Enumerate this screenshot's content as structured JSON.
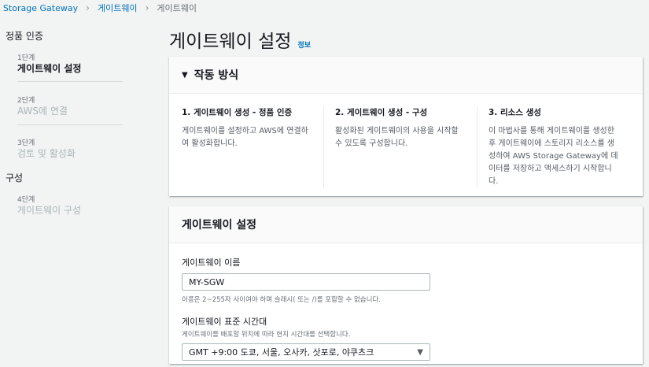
{
  "breadcrumb": {
    "items": [
      "Storage Gateway",
      "게이트웨이",
      "게이트웨이"
    ]
  },
  "sidebar": {
    "sections": [
      {
        "title": "정품 인증",
        "steps": [
          {
            "step": "1단계",
            "name": "게이트웨이 설정"
          },
          {
            "step": "2단계",
            "name": "AWS에 연결"
          },
          {
            "step": "3단계",
            "name": "검토 및 활성화"
          }
        ]
      },
      {
        "title": "구성",
        "steps": [
          {
            "step": "4단계",
            "name": "게이트웨이 구성"
          }
        ]
      }
    ]
  },
  "page": {
    "title": "게이트웨이 설정",
    "info_link": "정보"
  },
  "how_it_works": {
    "heading": "작동 방식",
    "columns": [
      {
        "title": "1. 게이트웨이 생성 - 정품 인증",
        "text": "게이트웨이를 설정하고 AWS에 연결하여 활성화합니다."
      },
      {
        "title": "2. 게이트웨이 생성 - 구성",
        "text": "활성화된 게이트웨이의 사용을 시작할 수 있도록 구성합니다."
      },
      {
        "title": "3. 리소스 생성",
        "text": "이 마법사를 통해 게이트웨이를 생성한 후 게이트웨이에 스토리지 리소스를 생성하여 AWS Storage Gateway에 데이터를 저장하고 액세스하기 시작합니다."
      }
    ]
  },
  "gateway_settings": {
    "heading": "게이트웨이 설정",
    "name_label": "게이트웨이 이름",
    "name_value": "MY-SGW",
    "name_constraint": "이름은 2~255자 사이여야 하며 슬래시( 또는 /)를 포함할 수 없습니다.",
    "tz_label": "게이트웨이 표준 시간대",
    "tz_desc": "게이트웨이를 배포할 위치에 따라 현지 시간대를 선택합니다.",
    "tz_value": "GMT +9:00 도쿄, 서울, 오사카, 삿포로, 야쿠츠크"
  }
}
